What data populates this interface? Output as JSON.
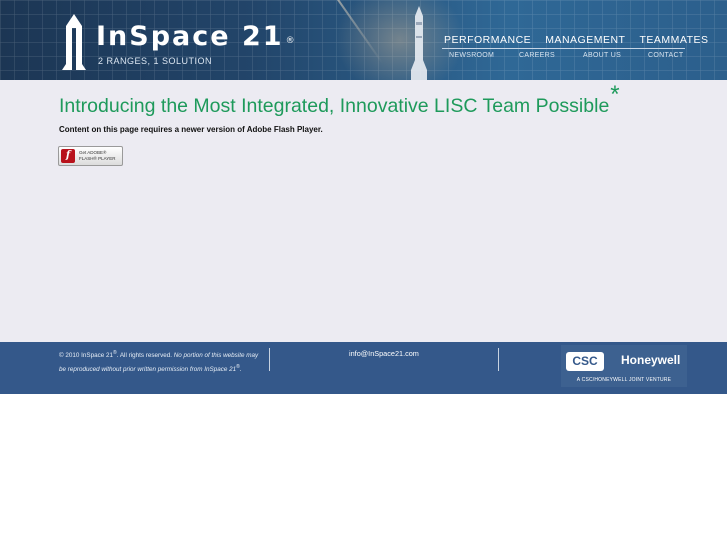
{
  "header": {
    "brand": "InSpace 21",
    "registered_mark": "®",
    "tagline": "2 RANGES, 1 SOLUTION",
    "main_nav": [
      "PERFORMANCE",
      "MANAGEMENT",
      "TEAMMATES"
    ],
    "sub_nav": [
      "NEWSROOM",
      "CAREERS",
      "ABOUT US",
      "CONTACT"
    ]
  },
  "main": {
    "headline": "Introducing the Most Integrated, Innovative LISC Team Possible",
    "headline_mark": "*",
    "flash_message": "Content on this page requires a newer version of Adobe Flash Player.",
    "flash_badge": {
      "icon_letter": "f",
      "line1": "Get ADOBE®",
      "line2": "FLASH® PLAYER"
    }
  },
  "footer": {
    "copyright_prefix": "© 2010 InSpace 21",
    "copyright_mark": "®",
    "rights": ". All rights reserved.",
    "notice": "No portion of this website may be reproduced without prior written permission from InSpace 21",
    "notice_mark": "®",
    "notice_end": ".",
    "email": "info@InSpace21.com",
    "partner_logo_1": "CSC",
    "partner_logo_2": "Honeywell",
    "joint_venture": "A CSC/HONEYWELL JOINT VENTURE"
  },
  "colors": {
    "header_blue": "#22456a",
    "headline_green": "#1e9a5b",
    "page_background": "#ecebf2",
    "footer_blue": "#34588a",
    "flash_red": "#b8121c"
  },
  "icons": [
    "inspace21-logo-mark-icon",
    "rocket-icon",
    "adobe-flash-icon"
  ]
}
